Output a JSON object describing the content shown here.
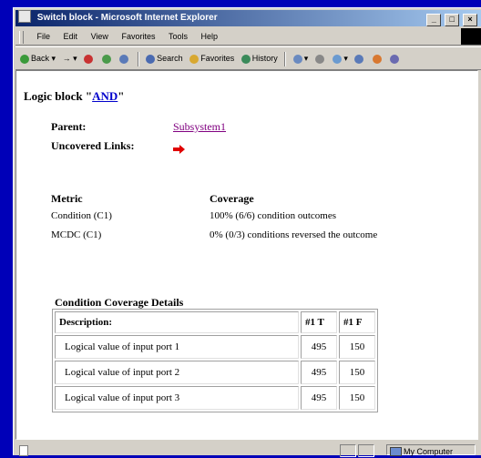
{
  "window": {
    "title": "Switch block - Microsoft Internet Explorer",
    "buttons": {
      "minimize": "_",
      "maximize": "□",
      "close": "×"
    }
  },
  "menu": [
    "File",
    "Edit",
    "View",
    "Favorites",
    "Tools",
    "Help"
  ],
  "toolbar": {
    "back": "Back",
    "forward": "→",
    "search": "Search",
    "favorites": "Favorites",
    "history": "History"
  },
  "page": {
    "heading_prefix": "Logic block \"",
    "heading_link": "AND",
    "heading_suffix": "\"",
    "parent_label": "Parent:",
    "parent_value": "Subsystem1",
    "uncovered_label": "Uncovered Links:",
    "metrics": {
      "header_metric": "Metric",
      "header_coverage": "Coverage",
      "rows": [
        {
          "metric": "Condition (C1)",
          "coverage": "100% (6/6) condition outcomes"
        },
        {
          "metric": "MCDC (C1)",
          "coverage": "0% (0/3) conditions reversed the outcome"
        }
      ]
    },
    "details": {
      "title": "Condition Coverage Details",
      "columns": [
        "Description:",
        "#1 T",
        "#1 F"
      ],
      "rows": [
        {
          "description": "Logical value of input port 1",
          "t": "495",
          "f": "150"
        },
        {
          "description": "Logical value of input port 2",
          "t": "495",
          "f": "150"
        },
        {
          "description": "Logical value of input port 3",
          "t": "495",
          "f": "150"
        }
      ]
    }
  },
  "status": {
    "zone": "My Computer"
  }
}
